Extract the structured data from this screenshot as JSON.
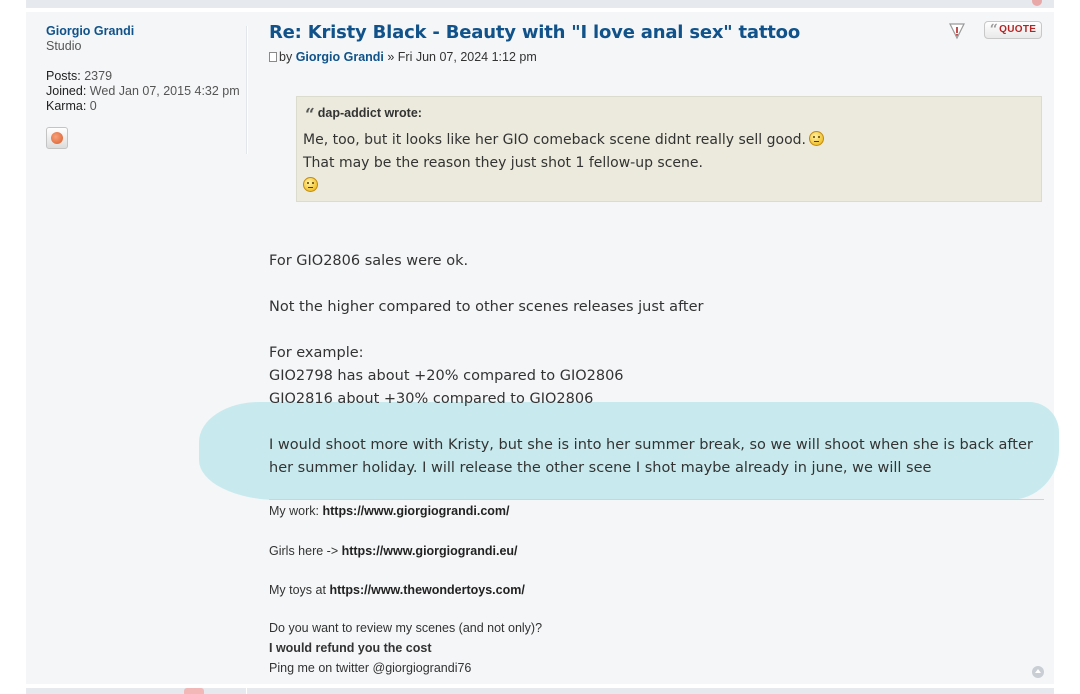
{
  "profile": {
    "username": "Giorgio Grandi",
    "rank": "Studio",
    "posts_label": "Posts:",
    "posts_value": "2379",
    "joined_label": "Joined:",
    "joined_value": "Wed Jan 07, 2015 4:32 pm",
    "karma_label": "Karma:",
    "karma_value": "0"
  },
  "post": {
    "title": "Re: Kristy Black - Beauty with \"I love anal sex\" tattoo",
    "by_prefix": "by",
    "author": "Giorgio Grandi",
    "date": "» Fri Jun 07, 2024 1:12 pm",
    "quote_button": "QUOTE",
    "quote": {
      "cite": "dap-addict wrote:",
      "line1": "Me, too, but it looks like her GIO comeback scene didnt really sell good.",
      "line2": "That may be the reason they just shot 1 fellow-up scene."
    },
    "paragraphs": {
      "p1": "For GIO2806 sales were ok.",
      "p2": "Not the higher compared to other scenes releases just after",
      "p3a": "For example:",
      "p3b": "GIO2798 has about +20% compared to GIO2806",
      "p3c": "GIO2816 about +30% compared to GIO2806",
      "p4": "I would shoot more with Kristy, but she is into her summer break, so we will shoot when she is back after her summer holiday. I will release the other scene I shot maybe already in june, we will see"
    }
  },
  "signature": {
    "work_label": "My work: ",
    "work_link": "https://www.giorgiograndi.com/",
    "girls_label": "Girls here -> ",
    "girls_link": "https://www.giorgiograndi.eu/",
    "toys_label": "My toys at ",
    "toys_link": "https://www.thewondertoys.com/",
    "review_line": "Do you want to review my scenes (and not only)?",
    "refund_line": "I would refund you the cost",
    "twitter_line": "Ping me on twitter @giorgiograndi76"
  },
  "colors": {
    "link": "#105289",
    "quote_bg": "#ebeadd",
    "highlight": "#bfe8ec",
    "post_bg": "#f4f6f8"
  },
  "icons": {
    "report": "warning-icon",
    "quote": "quote-icon",
    "post": "post-icon",
    "website": "website-icon",
    "top": "back-to-top-icon",
    "smiley": "confused-smiley-icon"
  }
}
